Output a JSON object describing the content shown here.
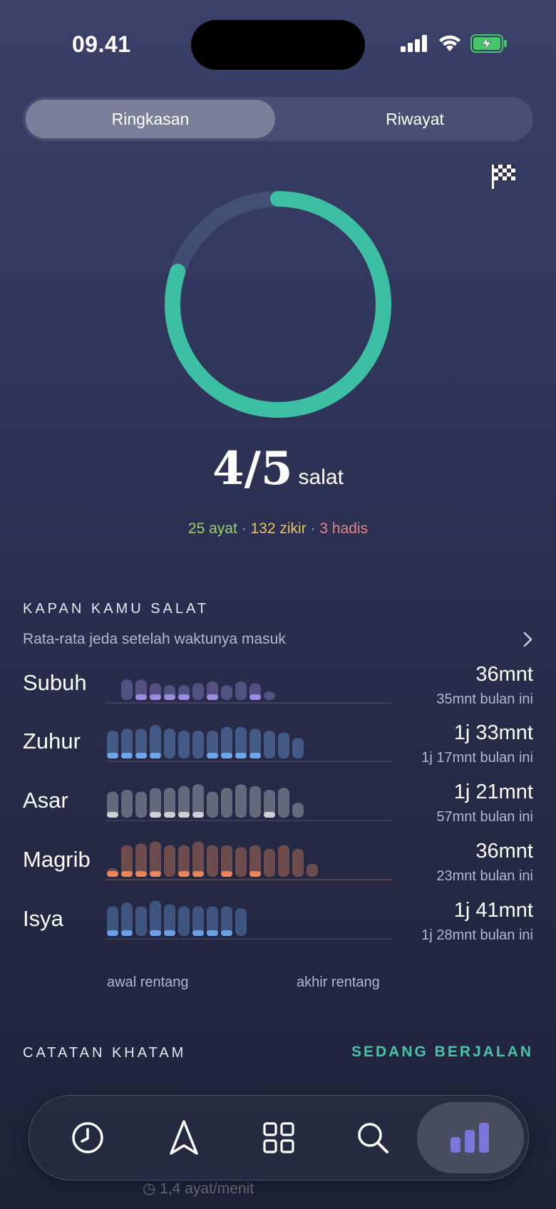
{
  "status_bar": {
    "time": "09.41"
  },
  "segments": {
    "summary": "Ringkasan",
    "history": "Riwayat"
  },
  "summary": {
    "progress_fraction": 0.8,
    "count": "4/5",
    "unit": "salat",
    "ayat": "25 ayat",
    "zikir": "132 zikir",
    "hadis": "3 hadis",
    "separator": "·",
    "ring_color": "#3dbfa4"
  },
  "prayer_section": {
    "title": "KAPAN KAMU SALAT",
    "subtitle": "Rata-rata jeda setelah waktunya masuk",
    "axis_start": "awal rentang",
    "axis_end": "akhir rentang",
    "rows": [
      {
        "name": "Subuh",
        "value": "36mnt",
        "sub": "35mnt bulan ini",
        "color": "#9c8be0",
        "bars": [
          0,
          0.55,
          0.55,
          0.45,
          0.4,
          0.4,
          0.45,
          0.5,
          0.4,
          0.5,
          0.45,
          0.2
        ],
        "marks": [
          1,
          0,
          1,
          1,
          1,
          1,
          0,
          1,
          0,
          0,
          1,
          0
        ]
      },
      {
        "name": "Zuhur",
        "value": "1j 33mnt",
        "sub": "1j 17mnt bulan ini",
        "color": "#6ea7ea",
        "bars": [
          0.75,
          0.8,
          0.8,
          0.9,
          0.8,
          0.75,
          0.75,
          0.75,
          0.85,
          0.85,
          0.8,
          0.75,
          0.7,
          0.55
        ],
        "marks": [
          1,
          1,
          1,
          1,
          0,
          0,
          0,
          1,
          1,
          1,
          1,
          0,
          0,
          0
        ]
      },
      {
        "name": "Asar",
        "value": "1j 21mnt",
        "sub": "57mnt bulan ini",
        "color": "#cfcfd6",
        "bars": [
          0.7,
          0.75,
          0.7,
          0.8,
          0.8,
          0.85,
          0.9,
          0.7,
          0.8,
          0.9,
          0.85,
          0.75,
          0.8,
          0.4
        ],
        "marks": [
          1,
          0,
          0,
          1,
          1,
          1,
          1,
          0,
          0,
          0,
          0,
          1,
          0,
          0
        ]
      },
      {
        "name": "Magrib",
        "value": "36mnt",
        "sub": "23mnt bulan ini",
        "color": "#e8865c",
        "bars": [
          0.2,
          0.85,
          0.9,
          0.95,
          0.85,
          0.85,
          0.95,
          0.85,
          0.85,
          0.8,
          0.85,
          0.75,
          0.85,
          0.75,
          0.35
        ],
        "marks": [
          1,
          1,
          1,
          1,
          0,
          1,
          1,
          0,
          1,
          0,
          1,
          0,
          0,
          0,
          0
        ]
      },
      {
        "name": "Isya",
        "value": "1j 41mnt",
        "sub": "1j 28mnt bulan ini",
        "color": "#6aa0e8",
        "bars": [
          0.8,
          0.9,
          0.8,
          0.95,
          0.85,
          0.8,
          0.8,
          0.8,
          0.8,
          0.75
        ],
        "marks": [
          1,
          1,
          0,
          1,
          1,
          0,
          1,
          1,
          1,
          0
        ]
      }
    ]
  },
  "khatam": {
    "title": "CATATAN KHATAM",
    "status": "SEDANG BERJALAN",
    "rate": "1,4 ayat/menit"
  },
  "tabbar": {
    "items": [
      {
        "name": "history-tab",
        "icon": "clock-icon"
      },
      {
        "name": "qibla-tab",
        "icon": "compass-arrow-icon"
      },
      {
        "name": "apps-tab",
        "icon": "grid-icon"
      },
      {
        "name": "search-tab",
        "icon": "search-icon"
      },
      {
        "name": "stats-tab",
        "icon": "bar-chart-icon",
        "active": true
      }
    ]
  }
}
